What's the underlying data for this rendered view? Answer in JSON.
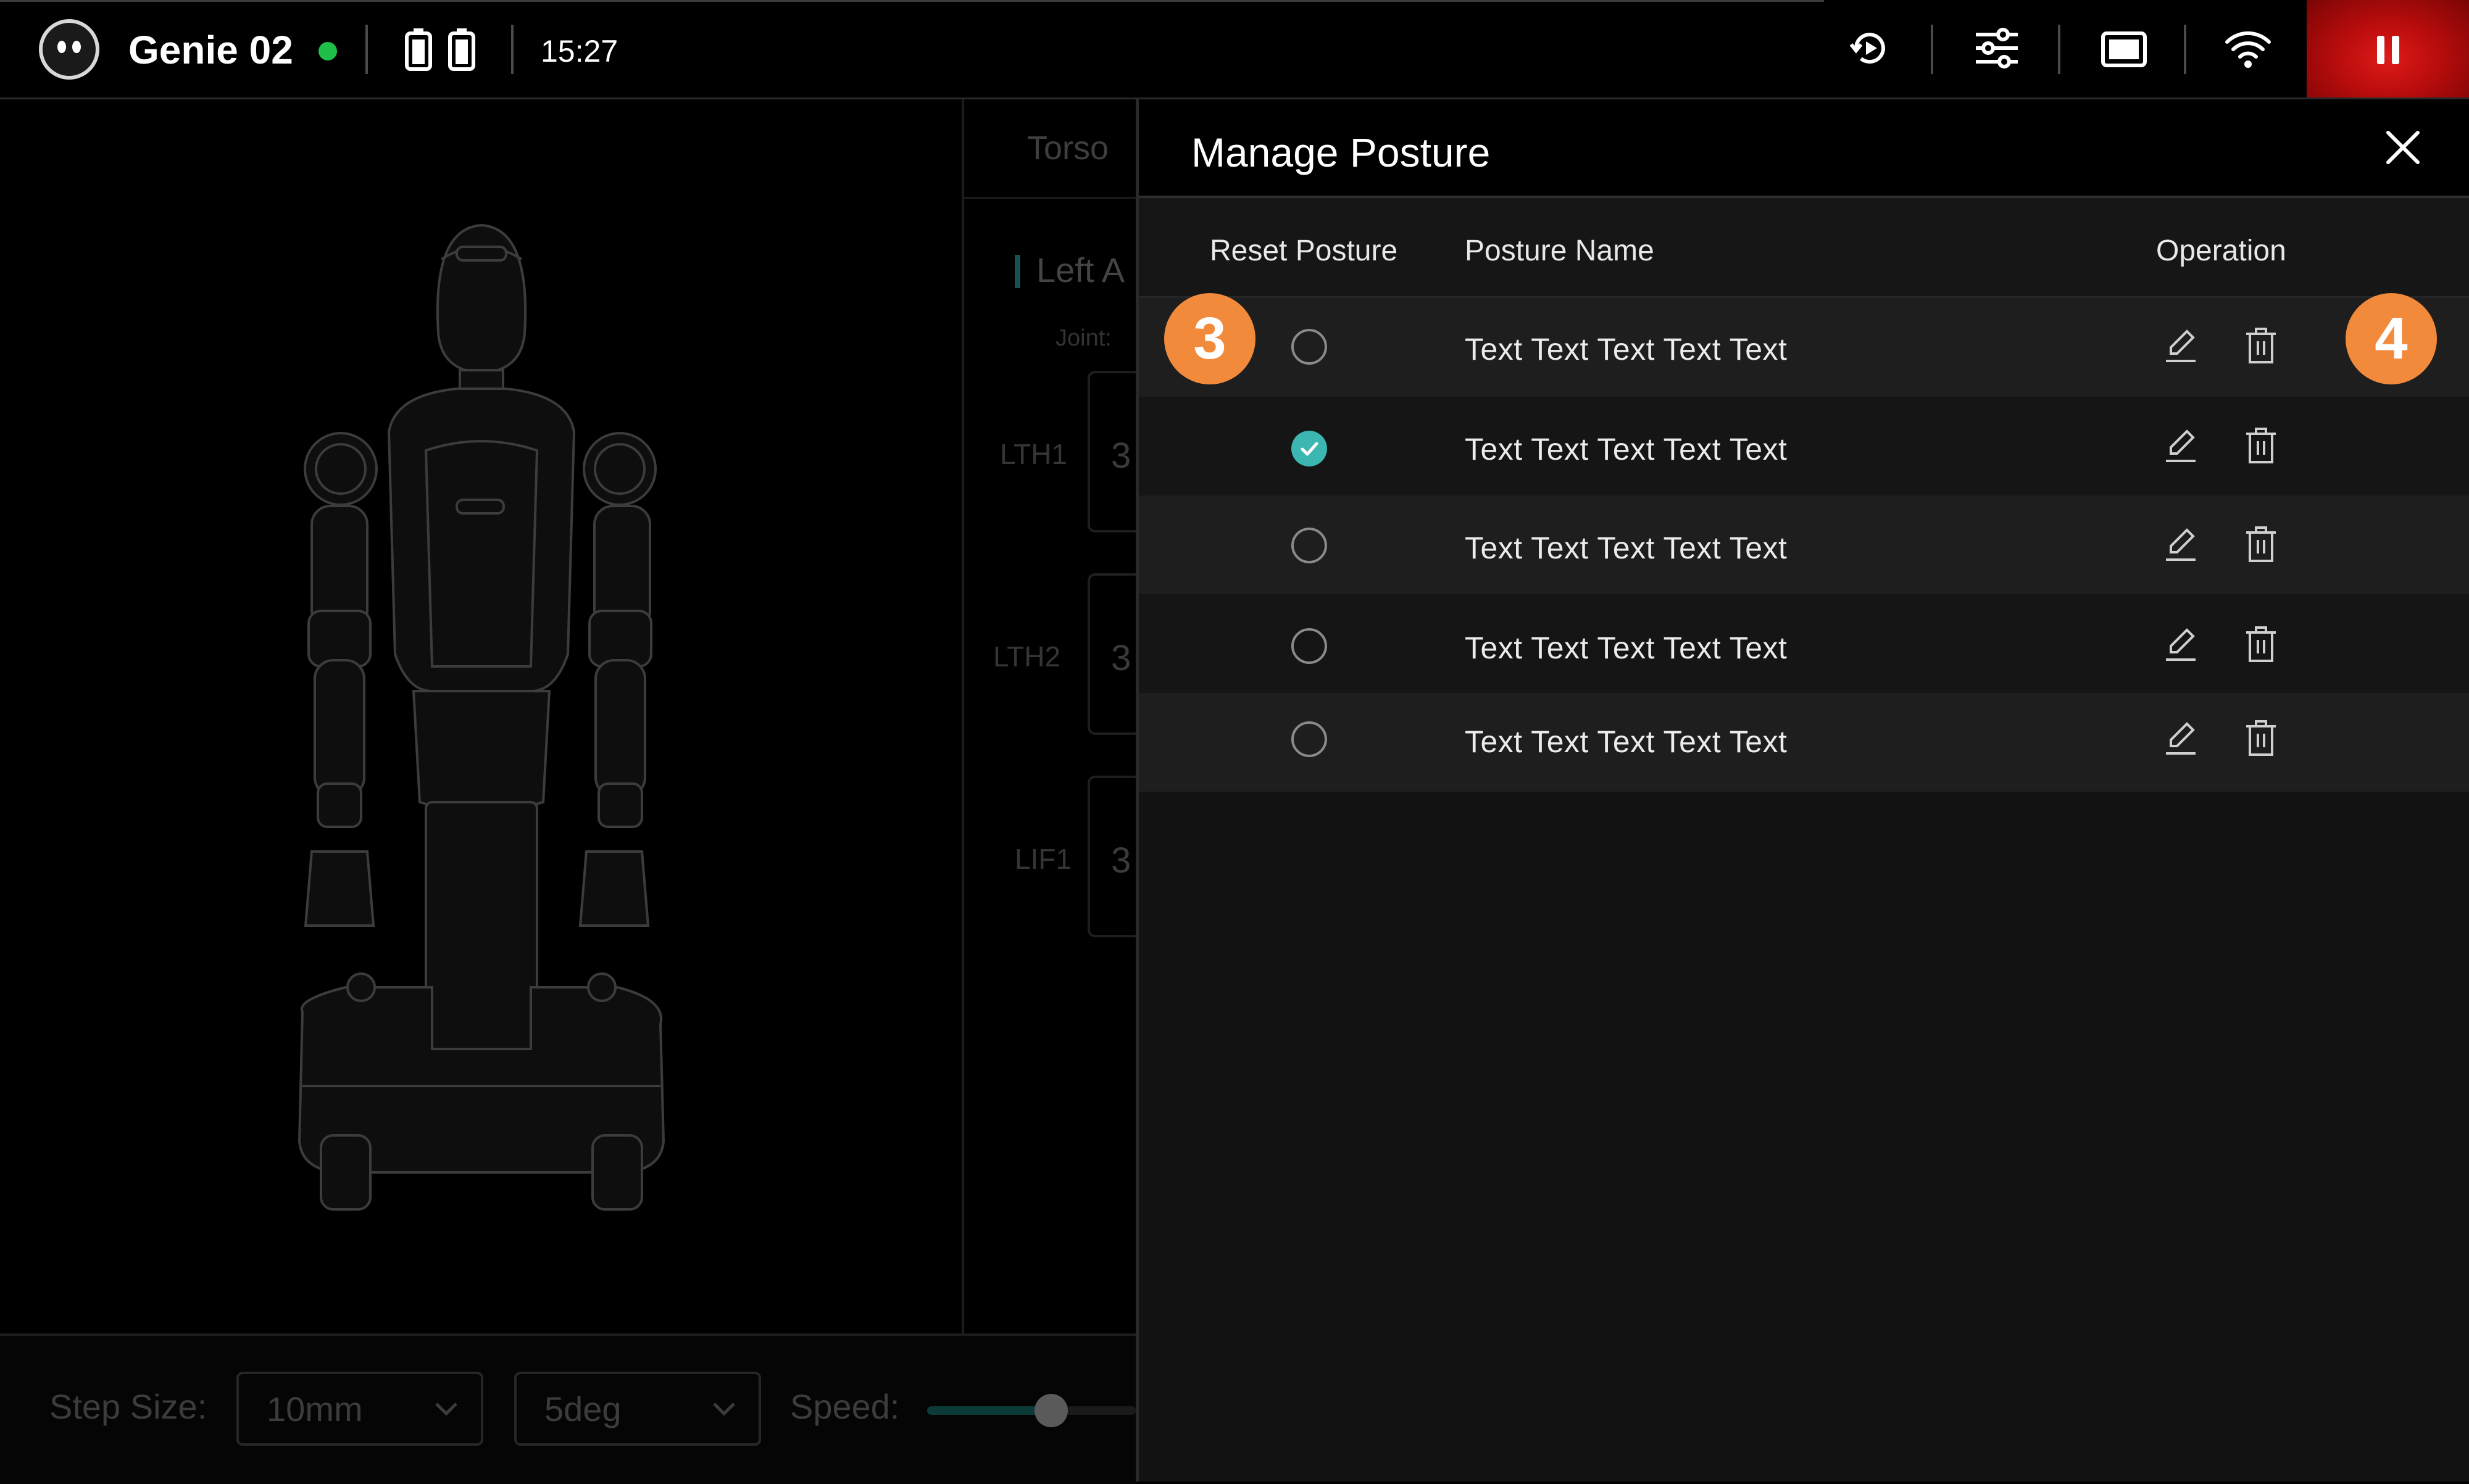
{
  "status_bar": {
    "robot_name": "Genie 02",
    "connection_color": "#1fbf4a",
    "time": "15:27",
    "icons": [
      "robot-face-icon",
      "battery-icon",
      "battery-icon",
      "replay-icon",
      "sliders-icon",
      "screen-icon",
      "wifi-icon",
      "pause-icon"
    ]
  },
  "joint_panel": {
    "tab": "Torso",
    "section": "Left A",
    "joint_label": "Joint:",
    "joints": [
      {
        "name": "LTH1",
        "value": "3"
      },
      {
        "name": "LTH2",
        "value": "3"
      },
      {
        "name": "LIF1",
        "value": "3"
      }
    ]
  },
  "bottom_bar": {
    "step_size_label": "Step Size:",
    "step_mm": "10mm",
    "step_deg": "5deg",
    "speed_label": "Speed:"
  },
  "modal": {
    "title": "Manage Posture",
    "columns": {
      "reset": "Reset Posture",
      "name": "Posture Name",
      "operation": "Operation"
    },
    "rows": [
      {
        "name": "Text Text Text Text Text",
        "selected": false
      },
      {
        "name": "Text Text Text Text Text",
        "selected": true
      },
      {
        "name": "Text Text Text Text Text",
        "selected": false
      },
      {
        "name": "Text Text Text Text Text",
        "selected": false
      },
      {
        "name": "Text Text Text Text Text",
        "selected": false
      }
    ],
    "accent_color": "#3bb6b0"
  },
  "markers": [
    "3",
    "4"
  ]
}
